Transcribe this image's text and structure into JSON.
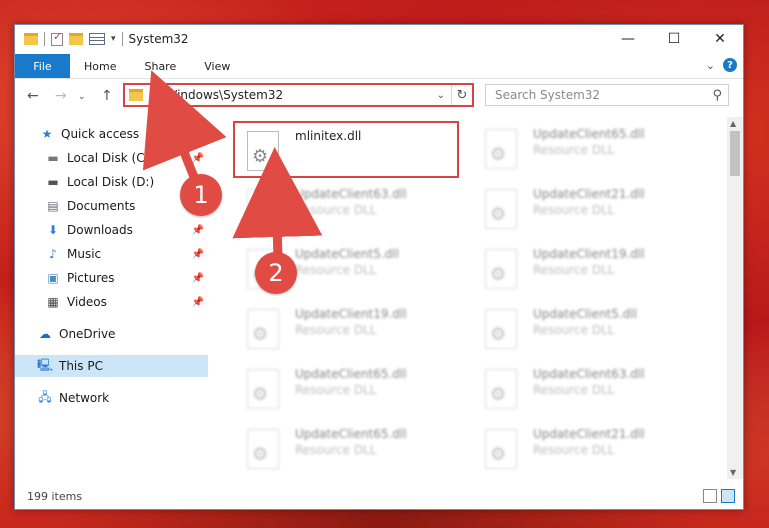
{
  "window": {
    "title": "System32",
    "controls": {
      "minimize": "—",
      "maximize": "☐",
      "close": "✕"
    }
  },
  "ribbon": {
    "file_label": "File",
    "tabs": [
      "Home",
      "Share",
      "View"
    ],
    "expand_glyph": "⌄",
    "help_glyph": "?"
  },
  "address": {
    "path": "C:\\Windows\\System32",
    "search_placeholder": "Search System32"
  },
  "sidebar": {
    "items": [
      {
        "label": "Quick access",
        "icon": "star-icon",
        "pinned": false
      },
      {
        "label": "Local Disk (C:)",
        "icon": "drive-icon",
        "pinned": true
      },
      {
        "label": "Local Disk (D:)",
        "icon": "drive-icon",
        "pinned": false
      },
      {
        "label": "Documents",
        "icon": "document-icon",
        "pinned": false
      },
      {
        "label": "Downloads",
        "icon": "download-icon",
        "pinned": true
      },
      {
        "label": "Music",
        "icon": "music-icon",
        "pinned": true
      },
      {
        "label": "Pictures",
        "icon": "picture-icon",
        "pinned": true
      },
      {
        "label": "Videos",
        "icon": "video-icon",
        "pinned": true
      },
      {
        "label": "OneDrive",
        "icon": "cloud-icon",
        "pinned": false
      },
      {
        "label": "This PC",
        "icon": "computer-icon",
        "pinned": false,
        "selected": true
      },
      {
        "label": "Network",
        "icon": "network-icon",
        "pinned": false
      }
    ]
  },
  "files": [
    {
      "name": "mlinitex.dll",
      "type": "",
      "highlighted": true
    },
    {
      "name": "UpdateClient65.dll",
      "type": "Resource DLL"
    },
    {
      "name": "UpdateClient63.dll",
      "type": "Resource DLL"
    },
    {
      "name": "UpdateClient21.dll",
      "type": "Resource DLL"
    },
    {
      "name": "UpdateClient5.dll",
      "type": "Resource DLL"
    },
    {
      "name": "UpdateClient19.dll",
      "type": "Resource DLL"
    },
    {
      "name": "UpdateClient19.dll",
      "type": "Resource DLL"
    },
    {
      "name": "UpdateClient5.dll",
      "type": "Resource DLL"
    },
    {
      "name": "UpdateClient65.dll",
      "type": "Resource DLL"
    },
    {
      "name": "UpdateClient63.dll",
      "type": "Resource DLL"
    },
    {
      "name": "UpdateClient65.dll",
      "type": "Resource DLL"
    },
    {
      "name": "UpdateClient21.dll",
      "type": "Resource DLL"
    }
  ],
  "status": {
    "item_count": "199 items"
  },
  "callouts": {
    "step1": "1",
    "step2": "2",
    "color": "#e04b44"
  }
}
